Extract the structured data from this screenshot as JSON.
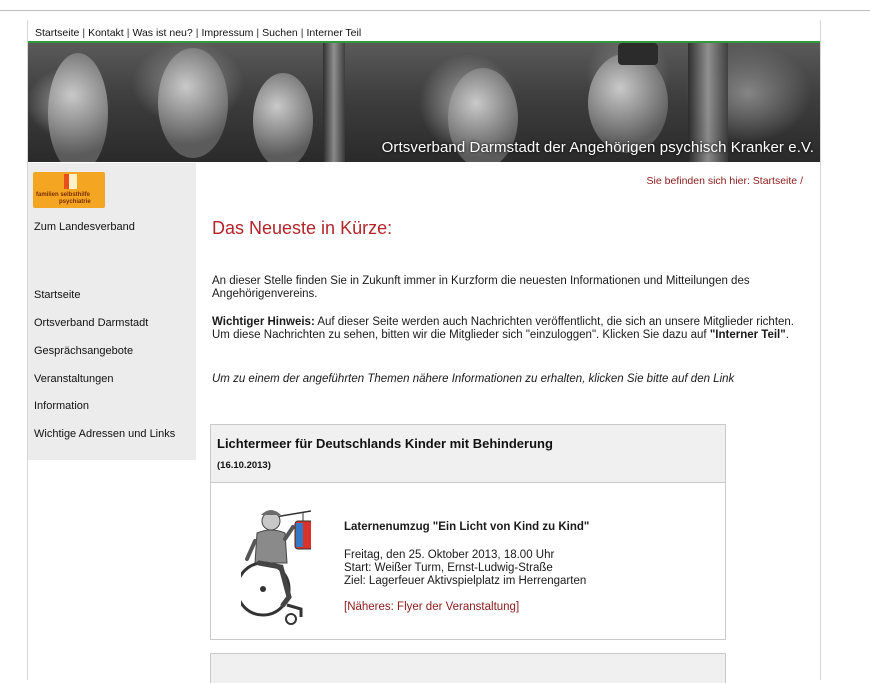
{
  "topnav": {
    "items": [
      "Startseite",
      "Kontakt",
      "Was ist neu?",
      "Impressum",
      "Suchen",
      "Interner Teil"
    ],
    "separator": "|"
  },
  "banner": {
    "title": "Ortsverband Darmstadt der Angehörigen psychisch Kranker e.V."
  },
  "logo": {
    "line1": "familien selbsthilfe",
    "line2": "psychiatrie"
  },
  "sidebar": {
    "landesverband": "Zum Landesverband",
    "items": [
      "Startseite",
      "Ortsverband Darmstadt",
      "Gesprächsangebote",
      "Veranstaltungen",
      "Information",
      "Wichtige Adressen und Links"
    ]
  },
  "breadcrumb": {
    "prefix": "Sie befinden sich hier:",
    "current": "Startseite /"
  },
  "main": {
    "heading": "Das Neueste in Kürze:",
    "intro": "An dieser Stelle finden Sie in Zukunft immer in Kurzform die neuesten Informationen und Mitteilungen des Angehörigenvereins.",
    "notice_label": "Wichtiger Hinweis:",
    "notice_text": " Auf dieser Seite werden auch Nachrichten veröffentlicht, die sich an unsere Mitglieder richten. Um diese Nachrichten zu sehen, bitten wir die Mitglieder sich \"einzuloggen\". Klicken Sie dazu auf ",
    "notice_link": "\"Interner Teil\"",
    "notice_end": ".",
    "hint": "Um zu einem der angeführten Themen nähere Informationen zu erhalten, klicken Sie bitte auf den Link"
  },
  "news": {
    "title": "Lichtermeer für Deutschlands Kinder mit Behinderung",
    "date": "(16.10.2013)",
    "event_title": "Laternenumzug \"Ein Licht von Kind zu Kind\"",
    "lines": [
      "Freitag, den 25. Oktober 2013, 18.00 Uhr",
      "Start: Weißer Turm, Ernst-Ludwig-Straße",
      "Ziel: Lagerfeuer Aktivspielplatz im Herrengarten"
    ],
    "link": "[Näheres: Flyer der Veranstaltung]"
  }
}
